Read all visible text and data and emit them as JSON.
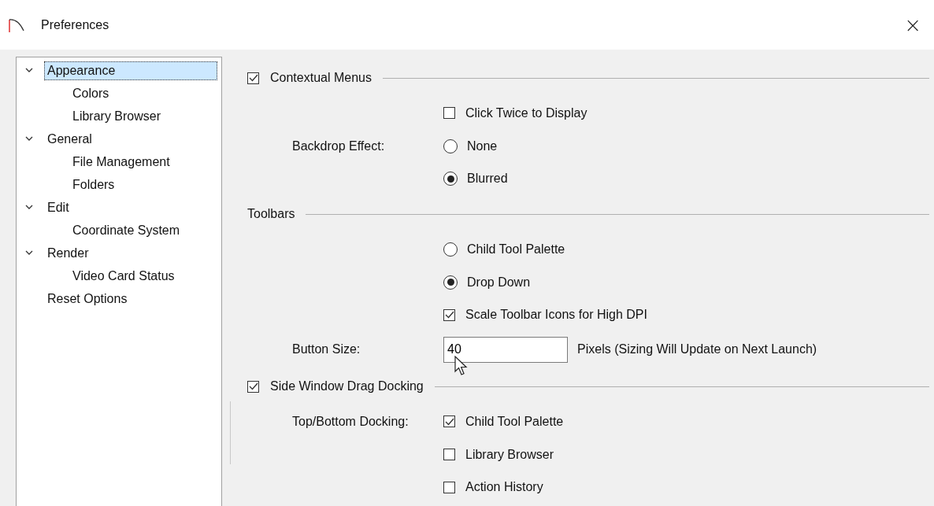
{
  "window": {
    "title": "Preferences",
    "close": "×"
  },
  "tree": [
    {
      "label": "Appearance",
      "expanded": true,
      "selected": true,
      "children": [
        {
          "label": "Colors",
          "selected": false
        },
        {
          "label": "Library Browser",
          "selected": false
        }
      ]
    },
    {
      "label": "General",
      "expanded": true,
      "selected": false,
      "children": [
        {
          "label": "File Management",
          "selected": false
        },
        {
          "label": "Folders",
          "selected": false
        }
      ]
    },
    {
      "label": "Edit",
      "expanded": true,
      "selected": false,
      "children": [
        {
          "label": "Coordinate System",
          "selected": false
        }
      ]
    },
    {
      "label": "Render",
      "expanded": true,
      "selected": false,
      "children": [
        {
          "label": "Video Card Status",
          "selected": false
        }
      ]
    },
    {
      "label": "Reset Options",
      "selected": false
    }
  ],
  "rows": [
    {
      "kind": "section",
      "text": "Contextual Menus",
      "checked": true
    },
    {
      "kind": "checkbox",
      "text": "Click Twice to Display",
      "checked": false
    },
    {
      "kind": "radio",
      "label": "Backdrop Effect:",
      "text": "None",
      "selected": false
    },
    {
      "kind": "radio",
      "text": "Blurred",
      "selected": true
    },
    {
      "kind": "section",
      "text": "Toolbars"
    },
    {
      "kind": "radio",
      "text": "Child Tool Palette",
      "selected": false
    },
    {
      "kind": "radio",
      "text": "Drop Down",
      "selected": true
    },
    {
      "kind": "checkbox",
      "text": "Scale Toolbar Icons for High DPI",
      "checked": true
    },
    {
      "kind": "input",
      "label": "Button Size:",
      "value": "40",
      "note": "Pixels (Sizing Will Update on Next Launch)"
    },
    {
      "kind": "section",
      "text": "Side Window Drag Docking",
      "checked": true
    },
    {
      "kind": "checkbox",
      "label": "Top/Bottom Docking:",
      "text": "Child Tool Palette",
      "checked": true
    },
    {
      "kind": "checkbox",
      "text": "Library Browser",
      "checked": false
    },
    {
      "kind": "checkbox",
      "text": "Action History",
      "checked": false
    }
  ]
}
